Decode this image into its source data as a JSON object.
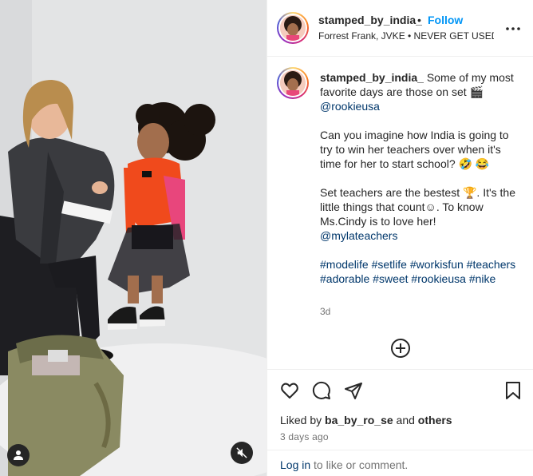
{
  "post": {
    "author": "stamped_by_india_",
    "separator": "•",
    "follow_label": "Follow",
    "audio": "Forrest Frank, JVKE • NEVER GET USED...",
    "more_icon": "more-horizontal-icon"
  },
  "caption": {
    "author": "stamped_by_india_",
    "line1": "Some of my most favorite days are those on set 🎬",
    "mention1": "@rookieusa",
    "para2": "Can you imagine how India is going to try to win her teachers over when it's time for her to start school? 🤣 😂",
    "para3": "Set teachers are the bestest 🏆. It's the little things that count☺. To know Ms.Cindy is to love her!",
    "mention2": "@mylateachers",
    "hashtags": [
      "#modelife",
      "#setlife",
      "#workisfun",
      "#teachers",
      "#adorable",
      "#sweet",
      "#rookieusa",
      "#nike"
    ],
    "age": "3d"
  },
  "actions": {
    "like_icon": "heart-icon",
    "comment_icon": "comment-icon",
    "share_icon": "send-icon",
    "save_icon": "bookmark-icon"
  },
  "likes": {
    "prefix": "Liked by",
    "user": "ba_by_ro_se",
    "and": "and",
    "others": "others"
  },
  "date_label": "3 days ago",
  "login": {
    "link": "Log in",
    "rest": "to like or comment."
  },
  "colors": {
    "accent": "#0095f6",
    "link": "#00376b",
    "muted": "#737373",
    "text": "#262626"
  }
}
